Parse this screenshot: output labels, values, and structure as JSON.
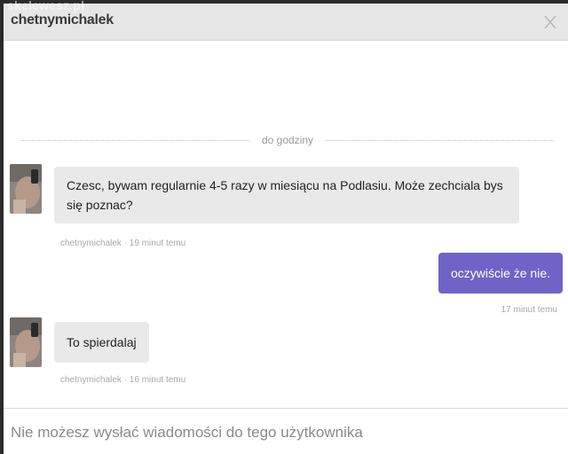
{
  "watermark": "skelewesz.pl",
  "header": {
    "username": "chetnymichalek"
  },
  "divider": {
    "label": "do godziny"
  },
  "messages": [
    {
      "direction": "in",
      "text": "Czesc, bywam regularnie 4-5 razy w miesiącu na Podlasiu. Może zechciala bys się poznac?",
      "meta": "chetnymichalek · 19 minut temu"
    },
    {
      "direction": "out",
      "text": "oczywiście że nie.",
      "meta": "17 minut temu"
    },
    {
      "direction": "in",
      "text": "To spierdalaj",
      "meta": "chetnymichalek · 16 minut temu"
    }
  ],
  "composer": {
    "notice": "Nie możesz wysłać wiadomości do tego użytkownika"
  },
  "colors": {
    "accent": "#6f63c8",
    "incoming_bubble": "#e9e9e9",
    "header_bg": "#e6e6e6"
  },
  "icons": {
    "close": "close-icon"
  }
}
